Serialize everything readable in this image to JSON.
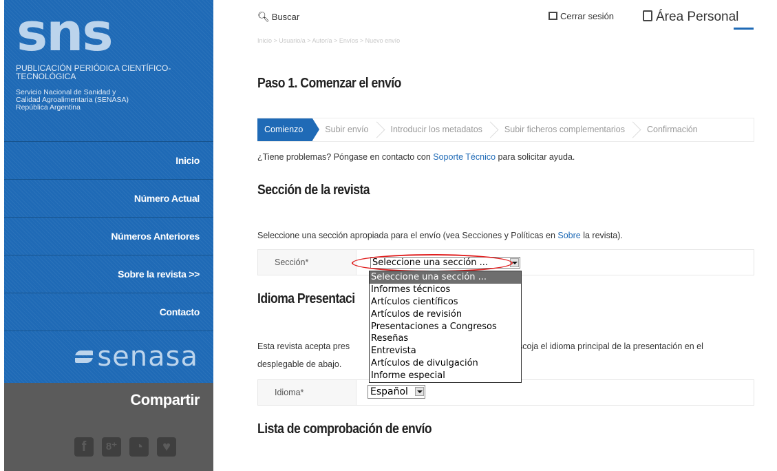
{
  "sidebar": {
    "logo": "sns",
    "publication": "PUBLICACIÓN PERIÓDICA CIENTÍFICO-TECNOLÓGICA",
    "org_line1": "Servicio Nacional de Sanidad y",
    "org_line2": "Calidad Agroalimentaria (SENASA)",
    "org_line3": "República Argentina",
    "nav": [
      "Inicio",
      "Número Actual",
      "Números Anteriores",
      "Sobre la revista >>",
      "Contacto"
    ],
    "senasa_logo": "senasa",
    "share_title": "Compartir",
    "share_icons": [
      "facebook-icon",
      "google-plus-icon",
      "rss-icon",
      "twitter-icon"
    ],
    "share_glyphs": [
      "f",
      "8⁺",
      "◔",
      "♥"
    ]
  },
  "topbar": {
    "search": "Buscar",
    "logout": "Cerrar sesión",
    "personal_area": "Área Personal"
  },
  "breadcrumb": "Inicio > Usuario/a > Autor/a > Envíos > Nuevo envío",
  "page_title": "Paso 1. Comenzar el envío",
  "steps": [
    {
      "label": "Comienzo",
      "active": true
    },
    {
      "label": "Subir envío"
    },
    {
      "label": "Introducir los metadatos"
    },
    {
      "label": "Subir ficheros complementarios"
    },
    {
      "label": "Confirmación"
    }
  ],
  "help": {
    "before": "¿Tiene problemas? Póngase en contacto con ",
    "link": "Soporte Técnico",
    "after": " para solicitar ayuda."
  },
  "section": {
    "heading": "Sección de la revista",
    "desc_before": "Seleccione una sección apropiada para el envío (vea Secciones y Políticas en ",
    "desc_link": "Sobre",
    "desc_after": " la revista).",
    "label": "Sección*",
    "selected": "Seleccione una sección ...",
    "options": [
      "Seleccione una sección ...",
      "Informes técnicos",
      "Artículos científicos",
      "Artículos de revisión",
      "Presentaciones a Congresos",
      "Reseñas",
      "Entrevista",
      "Artículos de divulgación",
      "Informe especial"
    ]
  },
  "language": {
    "heading": "Idioma Presentaci",
    "desc_part1": "Esta revista acepta pres",
    "desc_part2": "scoja el idioma principal de la presentación en el",
    "desc_part3": "desplegable de abajo.",
    "label": "Idioma*",
    "selected": "Español"
  },
  "checklist": {
    "heading": "Lista de comprobación de envío"
  },
  "colors": {
    "brand_blue": "#1f6ab6",
    "share_bg": "#5b5b5b",
    "highlight_red": "#e02020"
  }
}
